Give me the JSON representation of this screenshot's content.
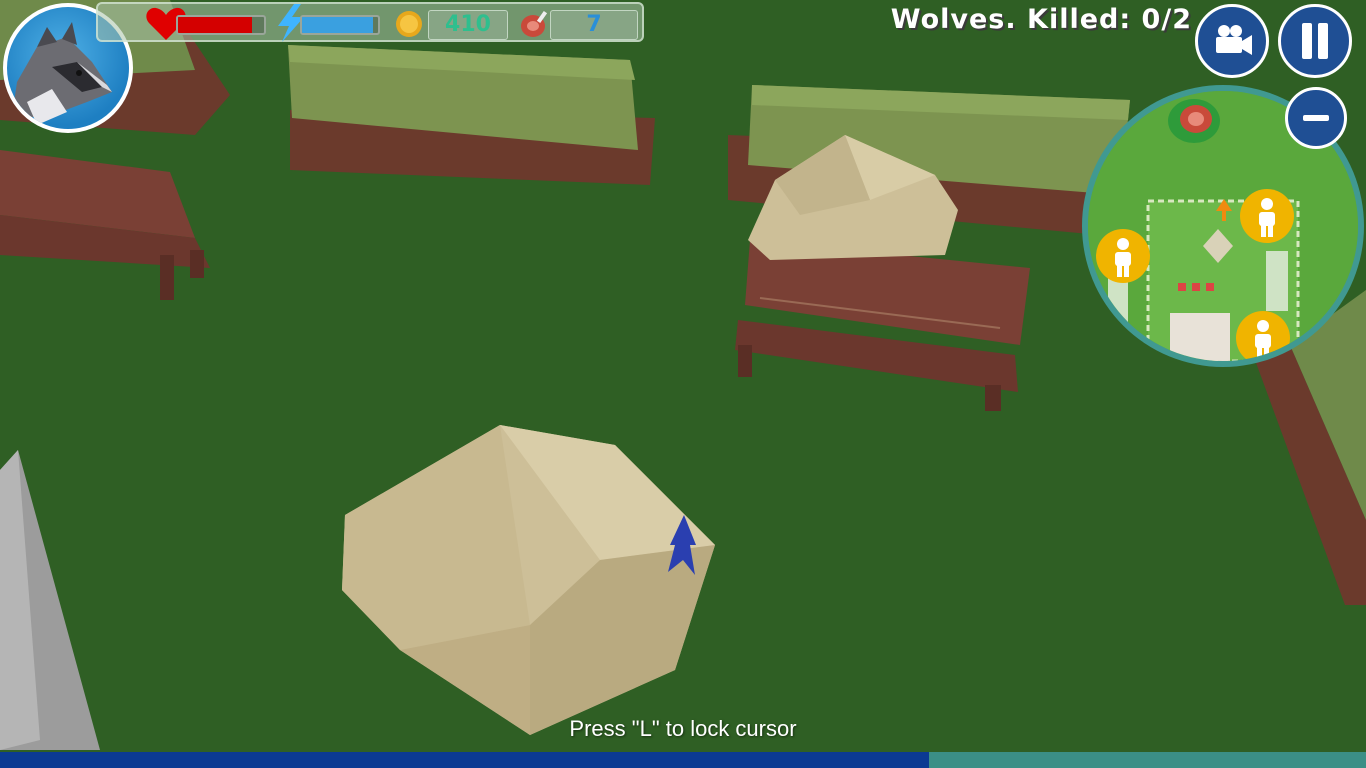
{
  "hud": {
    "health": 0.86,
    "energy": 0.93,
    "coins": "410",
    "meat": "7"
  },
  "mission": {
    "text": "Wolves. Killed: 0/2"
  },
  "buttons": {
    "camera_icon": "video-camera-icon",
    "pause_icon": "pause-icon",
    "zoom_out_icon": "minus-icon"
  },
  "hint": {
    "text": "Press \"L\" to lock cursor"
  },
  "loading": {
    "progress": 0.68
  },
  "colors": {
    "grass": "#2f5f24",
    "health": "#d40000",
    "energy": "#3aa0e0",
    "coins_text": "#2fbf8e",
    "meat_text": "#2a8fd8",
    "button": "#1f4f94",
    "progress_fill": "#0b3a92",
    "progress_track": "#3b8f86"
  }
}
